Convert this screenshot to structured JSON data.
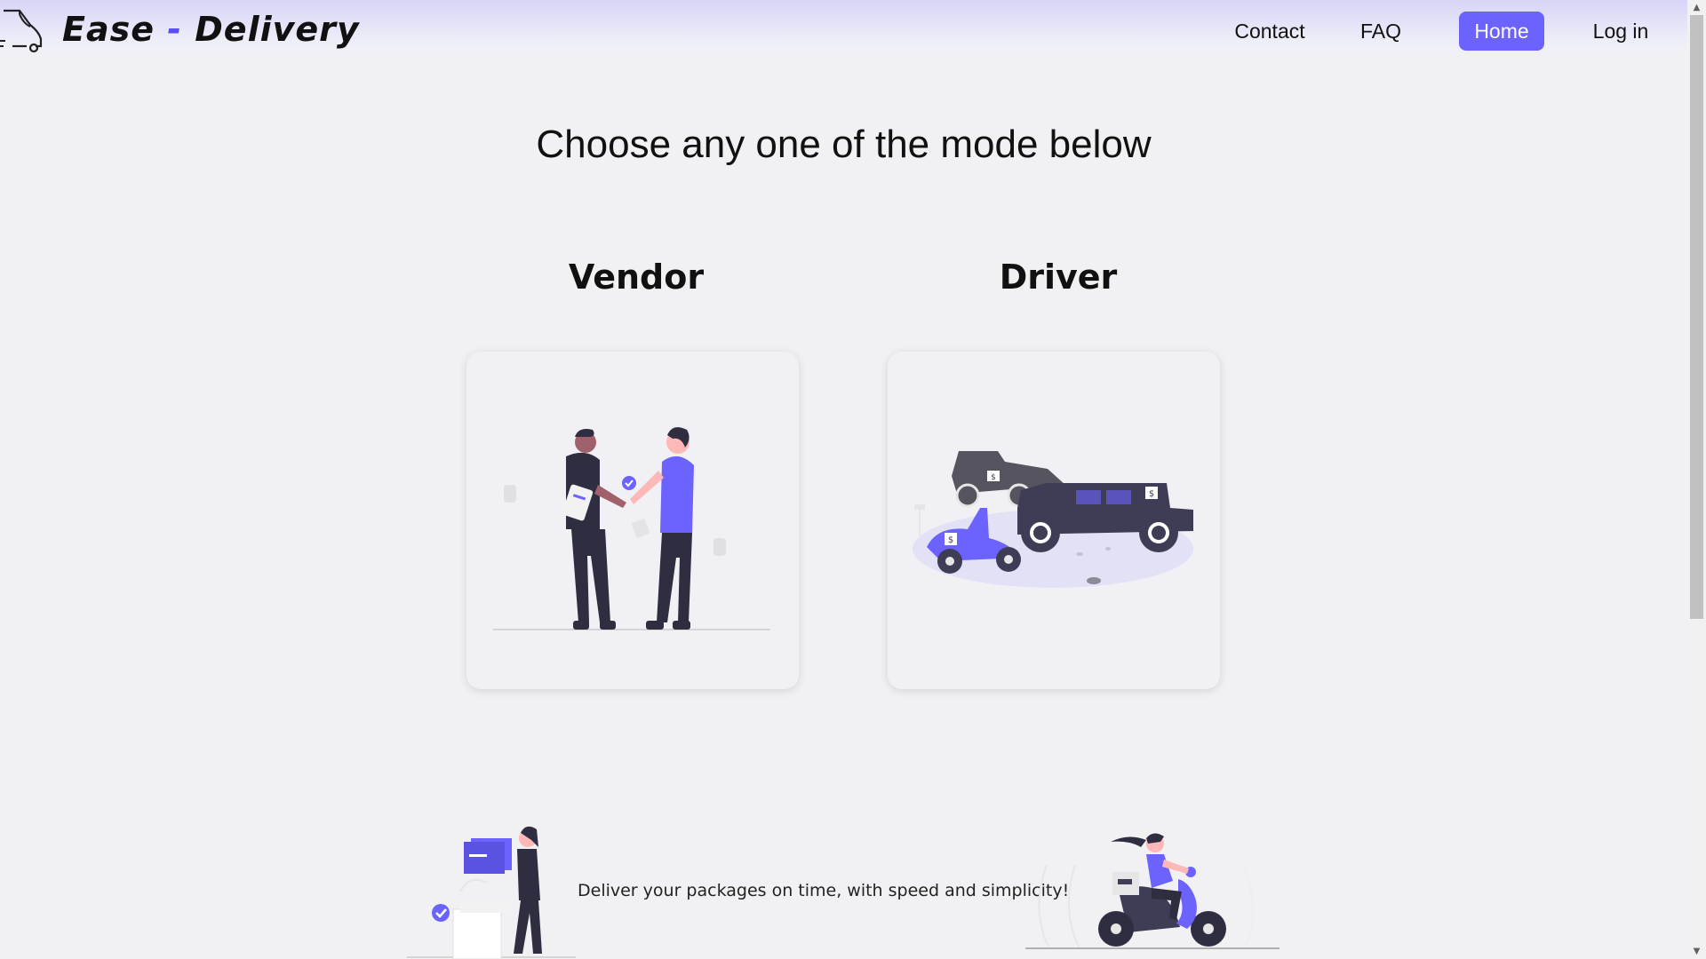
{
  "header": {
    "brand_name": "Ease",
    "brand_sep": "-",
    "brand_name2": "Delivery",
    "nav": [
      {
        "label": "Contact",
        "active": false
      },
      {
        "label": "FAQ",
        "active": false
      },
      {
        "label": "Home",
        "active": true
      },
      {
        "label": "Log in",
        "active": false
      }
    ]
  },
  "main": {
    "title": "Choose any one of the mode below",
    "modes": [
      {
        "label": "Vendor",
        "illustration": "handshake-illustration"
      },
      {
        "label": "Driver",
        "illustration": "vehicles-illustration"
      }
    ]
  },
  "footer": {
    "tagline": "Deliver your packages on time, with speed and simplicity!"
  },
  "colors": {
    "accent": "#6c63ff",
    "dark": "#3f3d56",
    "background": "#f1f1f4"
  }
}
